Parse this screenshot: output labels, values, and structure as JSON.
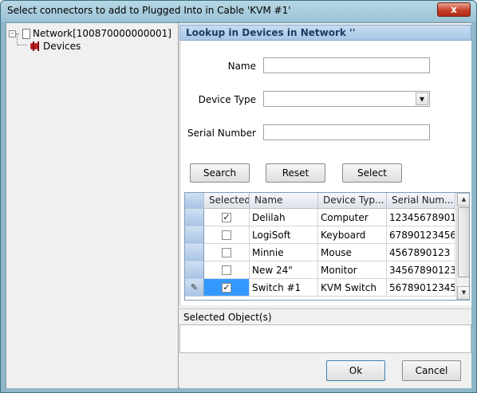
{
  "window": {
    "title": "Select connectors to add to Plugged Into in Cable 'KVM #1'",
    "close_glyph": "x"
  },
  "tree": {
    "root_label": "Network[100870000000001]",
    "expander_glyph": "-",
    "child_label": "Devices"
  },
  "lookup": {
    "header": "Lookup in Devices in Network ''",
    "fields": {
      "name_label": "Name",
      "name_value": "",
      "device_type_label": "Device Type",
      "device_type_value": "",
      "serial_label": "Serial Number",
      "serial_value": ""
    },
    "buttons": {
      "search": "Search",
      "reset": "Reset",
      "select": "Select"
    }
  },
  "grid": {
    "columns": [
      "Selected",
      "Name",
      "Device Typ...",
      "Serial Num..."
    ],
    "rows": [
      {
        "checked": true,
        "checkmark": "✓",
        "name": "Delilah",
        "type": "Computer",
        "serial": "12345678901..."
      },
      {
        "checked": false,
        "checkmark": "",
        "name": "LogiSoft",
        "type": "Keyboard",
        "serial": "67890123456"
      },
      {
        "checked": false,
        "checkmark": "",
        "name": "Minnie",
        "type": "Mouse",
        "serial": "4567890123"
      },
      {
        "checked": false,
        "checkmark": "",
        "name": "New 24\"",
        "type": "Monitor",
        "serial": "34567890123..."
      },
      {
        "checked": true,
        "checkmark": "✓",
        "name": "Switch #1",
        "type": "KVM Switch",
        "serial": "56789012345...",
        "editing": true,
        "row_marker": "✎"
      }
    ]
  },
  "selected_objects": {
    "header": "Selected Object(s)"
  },
  "footer": {
    "ok": "Ok",
    "cancel": "Cancel"
  }
}
